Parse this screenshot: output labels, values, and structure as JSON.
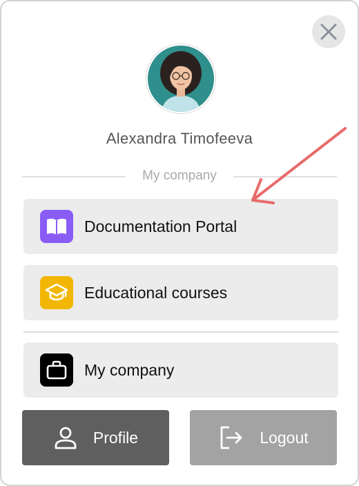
{
  "window": {
    "close_icon": "close-icon"
  },
  "profile": {
    "avatar_icon": "user-avatar-photo",
    "name": "Alexandra Timofeeva"
  },
  "section": {
    "title": "My company"
  },
  "menu": {
    "items": [
      {
        "label": "Documentation Portal",
        "icon": "book-icon",
        "icon_color": "#8a5cf6"
      },
      {
        "label": "Educational courses",
        "icon": "graduation-cap-icon",
        "icon_color": "#f2b705"
      },
      {
        "label": "My company",
        "icon": "briefcase-icon",
        "icon_color": "#000000"
      }
    ]
  },
  "actions": {
    "profile": {
      "label": "Profile",
      "icon": "person-icon",
      "color": "#5f5f5f"
    },
    "logout": {
      "label": "Logout",
      "icon": "logout-icon",
      "color": "#a3a3a3"
    }
  },
  "annotation": {
    "arrow_color": "#e86a6a"
  }
}
